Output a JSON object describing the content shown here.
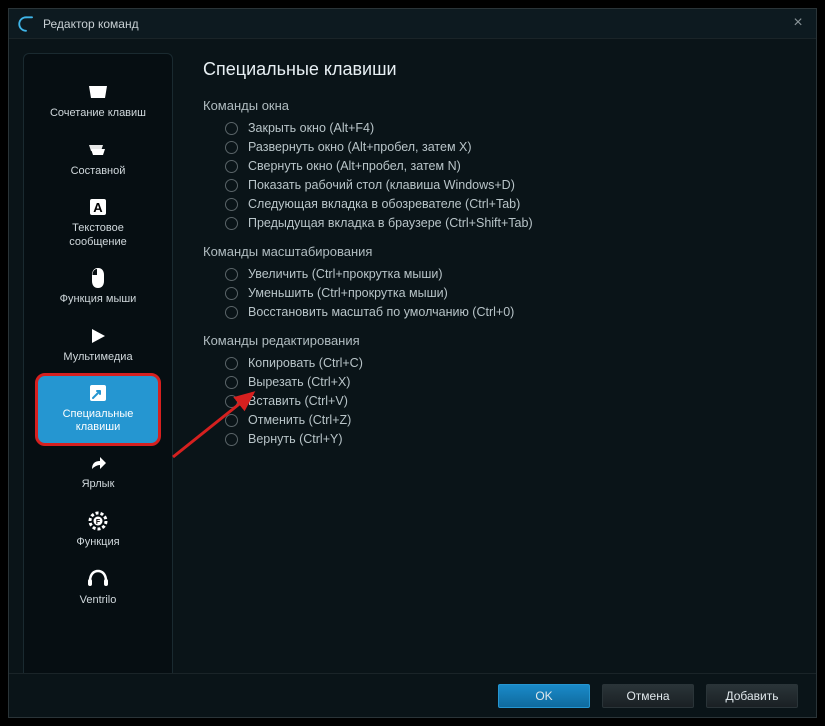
{
  "window": {
    "title": "Редактор команд"
  },
  "sidebar": {
    "items": [
      {
        "label": "Сочетание клавиш"
      },
      {
        "label": "Составной"
      },
      {
        "label": "Текстовое сообщение"
      },
      {
        "label": "Функция мыши"
      },
      {
        "label": "Мультимедиа"
      },
      {
        "label": "Специальные клавиши"
      },
      {
        "label": "Ярлык"
      },
      {
        "label": "Функция"
      },
      {
        "label": "Ventrilo"
      }
    ],
    "selected_index": 5
  },
  "content": {
    "title": "Специальные клавиши",
    "sections": [
      {
        "title": "Команды окна",
        "options": [
          "Закрыть окно (Alt+F4)",
          "Развернуть окно (Alt+пробел, затем X)",
          "Свернуть окно (Alt+пробел, затем N)",
          "Показать рабочий стол (клавиша Windows+D)",
          "Следующая вкладка в обозревателе (Ctrl+Tab)",
          "Предыдущая вкладка в браузере (Ctrl+Shift+Tab)"
        ]
      },
      {
        "title": "Команды масштабирования",
        "options": [
          "Увеличить (Ctrl+прокрутка мыши)",
          "Уменьшить (Ctrl+прокрутка мыши)",
          "Восстановить масштаб по умолчанию (Ctrl+0)"
        ]
      },
      {
        "title": "Команды редактирования",
        "options": [
          "Копировать (Ctrl+C)",
          "Вырезать (Ctrl+X)",
          "Вставить (Ctrl+V)",
          "Отменить (Ctrl+Z)",
          "Вернуть (Ctrl+Y)"
        ]
      }
    ]
  },
  "buttons": {
    "ok": "OK",
    "cancel": "Отмена",
    "add": "Добавить"
  }
}
